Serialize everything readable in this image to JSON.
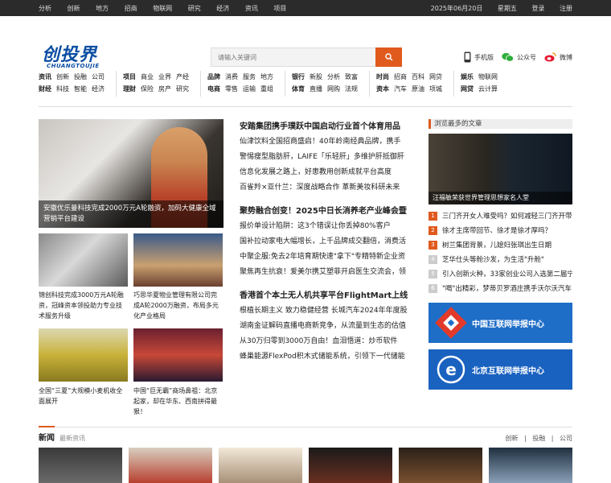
{
  "topbar": {
    "left": [
      "分析",
      "创新",
      "地方",
      "招商",
      "物联网",
      "研究",
      "经济",
      "资讯",
      "项目"
    ],
    "date": "2025年06月20日",
    "weekday": "星期五",
    "login": "登录",
    "register": "注册"
  },
  "logo": {
    "cn": "创投界",
    "en": "CHUANGTOUJIE"
  },
  "search": {
    "placeholder": "请输入关键词"
  },
  "header_links": {
    "mobile": "手机版",
    "wechat": "公众号",
    "weibo": "微博"
  },
  "nav": [
    {
      "r1": [
        "资讯",
        "创新",
        "投融",
        "公司"
      ],
      "r2": [
        "财经",
        "科技",
        "智能",
        "经济"
      ]
    },
    {
      "r1": [
        "项目",
        "商业",
        "业界",
        "产经"
      ],
      "r2": [
        "理财",
        "保险",
        "房产",
        "研究"
      ]
    },
    {
      "r1": [
        "品牌",
        "消费",
        "服务",
        "地方"
      ],
      "r2": [
        "电商",
        "零售",
        "运输",
        "重组"
      ]
    },
    {
      "r1": [
        "银行",
        "新股",
        "分析",
        "致富"
      ],
      "r2": [
        "体育",
        "直播",
        "网购",
        "法规"
      ]
    },
    {
      "r1": [
        "时尚",
        "招商",
        "百科",
        "网贷"
      ],
      "r2": [
        "资本",
        "汽车",
        "原油",
        "项城"
      ]
    },
    {
      "r1": [
        "娱乐",
        "物联网"
      ],
      "r2": [
        "网贷",
        "云计算"
      ]
    }
  ],
  "feature": {
    "caption": "安徽优乐曼科技完成2000万元A轮融资，加码大健康全域营销平台建设"
  },
  "thumbs": [
    {
      "caption": "锦创科技完成3000万元A轮融资，冠峰资本领投助力专业技术服务升级"
    },
    {
      "caption": "巧思华夏物业管理有限公司完成A轮2000万融资，布局多元化产业格局"
    },
    {
      "caption": "全国“三夏”大规模小麦机收全面展开"
    },
    {
      "caption": "中国“巨无霸”商场鼻祖：北京起家，却在华东、西南拼得最狠！"
    }
  ],
  "headlines": [
    {
      "title": "安踏集团携手璞跃中国启动行业首个体育用品",
      "items": [
        "仙津饮料全国招商盛启！40年岭南经典品牌，携手",
        "警惕瘦型脂肪肝，LAIFE「乐轻肝」多维护肝抵御肝",
        "信息化发展之路上，好患教用创新成就平台高度",
        "百雀羚×亚什兰：深度战略合作 革新美妆科研未来"
      ]
    },
    {
      "title": "聚势融合创变！2025中日长消养老产业峰会暨",
      "items": [
        "报价单设计陷阱：这3个错误让你丢掉80%客户",
        "国补拉动家电大幅增长，上千品牌成交翻倍，消费活",
        "中聚企服:免去2年培育期快速\"拿下\"专精特新企业资",
        "聚焦再生抗衰！爱美尔携艾塑菲开启医生交流会，领"
      ]
    },
    {
      "title": "香港首个本土无人机共享平台FlightMart上线",
      "items": [
        "根植长期主义 致力稳健经营 长城汽车2024年年度股",
        "湖南金证解码直播电商新竞争，从流量到生态的估值",
        "从30万归零到3000万自由！血泪悟道：炒币软件",
        "蜂巢能源FlexPod积木式储能系统，引领下一代储能"
      ]
    }
  ],
  "sidebar": {
    "heading": "浏览最多的文章",
    "image_caption": "汪福敏荣获世界管理思想家名人堂",
    "list": [
      "三门齐开女人难受吗？如何减轻三门齐开带",
      "徐才主席带回节、徐才是徐才厚吗？",
      "树兰集团背景，儿媳妇张琪出生日期",
      "芝华仕头等舱沙发，为生活\"升舱\"",
      "引入创新火种，33家创业公司入选第二届宁",
      "\"喝\"出精彩，梦蒂贝罗酒庄携手沃尔沃汽车"
    ],
    "banner1": "中国互联网举报中心",
    "banner2": "北京互联网举报中心"
  },
  "newsbar": {
    "title": "新闻",
    "subtitle": "最新资讯",
    "links": [
      "创新",
      "投融",
      "公司"
    ],
    "sep": "|"
  },
  "colors": {
    "accent": "#e05a1e",
    "brand": "#0a4da2",
    "topbar": "#2b2b2b"
  }
}
